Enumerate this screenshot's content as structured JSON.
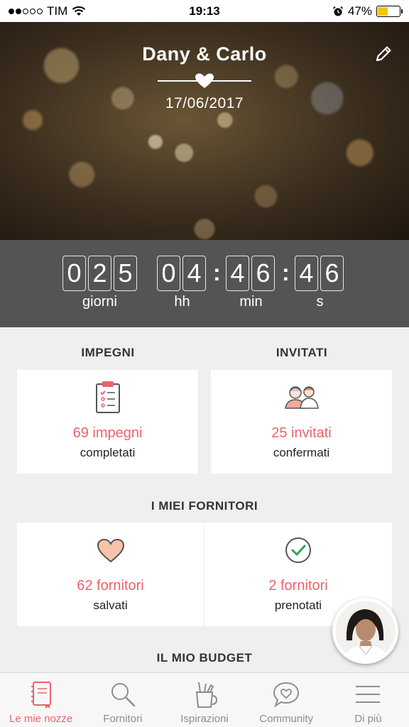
{
  "status_bar": {
    "carrier": "TIM",
    "time": "19:13",
    "battery": "47%",
    "battery_level": 0.47
  },
  "hero": {
    "couple": "Dany & Carlo",
    "date": "17/06/2017"
  },
  "countdown": {
    "days": [
      "0",
      "2",
      "5"
    ],
    "hours": [
      "0",
      "4"
    ],
    "minutes": [
      "4",
      "6"
    ],
    "seconds": [
      "4",
      "6"
    ],
    "labels": {
      "days": "giorni",
      "hours": "hh",
      "minutes": "min",
      "seconds": "s"
    }
  },
  "sections": {
    "impegni": {
      "title": "IMPEGNI",
      "value": "69 impegni",
      "sub": "completati"
    },
    "invitati": {
      "title": "INVITATI",
      "value": "25 invitati",
      "sub": "confermati"
    },
    "fornitori_title": "I MIEI FORNITORI",
    "fornitori_saved": {
      "value": "62 fornitori",
      "sub": "salvati"
    },
    "fornitori_booked": {
      "value": "2 fornitori",
      "sub": "prenotati"
    },
    "budget_title": "IL MIO BUDGET"
  },
  "tabs": [
    {
      "label": "Le mie nozze",
      "icon": "notebook-icon",
      "active": true
    },
    {
      "label": "Fornitori",
      "icon": "search-icon",
      "active": false
    },
    {
      "label": "Ispirazioni",
      "icon": "pencil-cup-icon",
      "active": false
    },
    {
      "label": "Community",
      "icon": "chat-heart-icon",
      "active": false
    },
    {
      "label": "Di più",
      "icon": "menu-icon",
      "active": false
    }
  ],
  "colors": {
    "accent": "#e8646b",
    "countdown_bg": "#545454",
    "background": "#efefef"
  }
}
